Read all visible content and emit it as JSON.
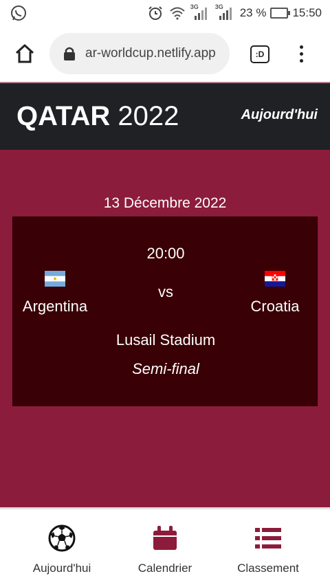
{
  "status_bar": {
    "net1": "3G",
    "net2": "3G",
    "battery": "23 %",
    "time": "15:50"
  },
  "browser": {
    "url": "ar-worldcup.netlify.app",
    "tabs_label": ":D"
  },
  "header": {
    "brand_bold": "QATAR",
    "brand_light": "2022",
    "today_link": "Aujourd'hui"
  },
  "match": {
    "date": "13 Décembre 2022",
    "time": "20:00",
    "vs": "vs",
    "home_team": "Argentina",
    "away_team": "Croatia",
    "venue": "Lusail Stadium",
    "stage": "Semi-final"
  },
  "nav": {
    "items": [
      {
        "label": "Aujourd'hui",
        "icon": "soccer-ball-icon"
      },
      {
        "label": "Calendrier",
        "icon": "calendar-icon"
      },
      {
        "label": "Classement",
        "icon": "list-icon"
      }
    ]
  },
  "colors": {
    "accent": "#8c1c3b",
    "card": "#390005",
    "header": "#1f2125"
  }
}
